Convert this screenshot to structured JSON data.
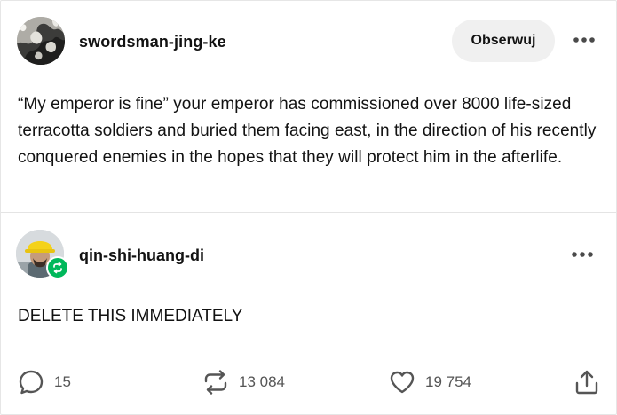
{
  "post": {
    "author": "swordsman-jing-ke",
    "follow_label": "Obserwuj",
    "text": "“My emperor is fine” your emperor has commissioned over 8000 life-sized terracotta soldiers and buried them facing east, in the direction of his recently conquered enemies in the hopes that they will protect him in the afterlife."
  },
  "reblog": {
    "author": "qin-shi-huang-di",
    "text": "DELETE THIS IMMEDIATELY"
  },
  "footer": {
    "comments": "15",
    "reblogs": "13 084",
    "likes": "19 754"
  },
  "icons": {
    "reblog_badge_color": "#00b85b",
    "more": "more-options-icon",
    "comment": "comment-icon",
    "reblog": "reblog-icon",
    "like": "heart-icon",
    "share": "share-icon"
  }
}
